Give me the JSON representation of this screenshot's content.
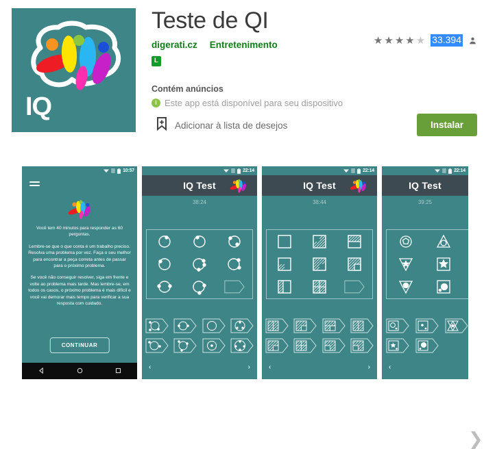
{
  "app": {
    "title": "Teste de QI",
    "developer": "digerati.cz",
    "category": "Entretenimento",
    "content_rating": "L",
    "icon_label": "IQ",
    "ads_note": "Contém anúncios",
    "device_note": "Este app está disponível para seu dispositivo",
    "wishlist_label": "Adicionar à lista de desejos",
    "install_label": "Instalar",
    "rating_stars_filled": 4,
    "rating_stars_total": 5,
    "rating_count": "33.394",
    "accent_green": "#689f38",
    "link_green": "#0f7d16",
    "teal": "#3D8587",
    "highlight_blue": "#338bff"
  },
  "screenshots": [
    {
      "status_time": "10:57",
      "body_paragraphs": [
        "Você tem 40 minutos para responder as 60 perguntas.",
        "Lembre-se que o que conta é um trabalho preciso. Resolva uma problema por vez. Faça o seu melhor para encontrar a peça correta antes de passar para o próximo problema.",
        "Se você não conseguir resolver, siga em frente e volte ao problema mais tarde. Mas lembre-se, em todos os casos, o próximo problema é mais difícil e você vai demorar mais tempo para verificar a sua resposta com cuidado."
      ],
      "continue_label": "CONTINUAR"
    },
    {
      "status_time": "22:14",
      "appbar_title": "IQ Test",
      "timer": "38:24",
      "puzzle_type": "circles-dots",
      "prev_label": "‹",
      "next_label": "›"
    },
    {
      "status_time": "22:14",
      "appbar_title": "IQ Test",
      "timer": "38:44",
      "puzzle_type": "squares-hatched",
      "prev_label": "‹",
      "next_label": "›"
    },
    {
      "status_time": "22:14",
      "appbar_title": "IQ Test",
      "timer": "39:25",
      "puzzle_type": "geometric-shapes",
      "prev_label": "‹",
      "next_label": "›"
    }
  ],
  "carousel": {
    "next_arrow": "❯"
  }
}
